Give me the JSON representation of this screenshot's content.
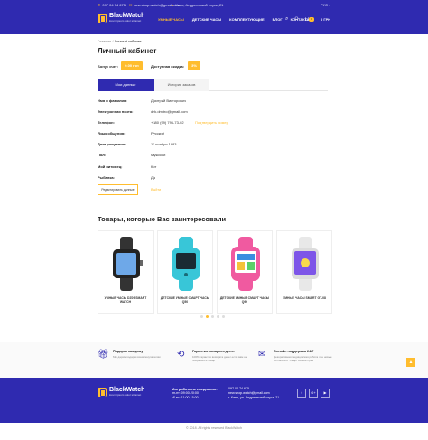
{
  "header": {
    "phone": "097 04 74 675",
    "email": "new.shop.watch@gmail.com",
    "address": "Киев, Андреевский спуск, 21",
    "language": "РУС",
    "logo_name": "BlackWatch",
    "logo_tagline": "lorem ipsum dolor sit amet",
    "nav": [
      "Умные часы",
      "Детские часы",
      "Комплектующие",
      "Блог",
      "Контакты"
    ],
    "cart_count": "0",
    "cart_sum": "0 ГРН"
  },
  "breadcrumbs": {
    "home": "Главная",
    "current": "Личный кабинет"
  },
  "page_title": "Личный кабинет",
  "bonus": {
    "label": "Бонус счет:",
    "value": "0.00 грн"
  },
  "discount": {
    "label": "Доступная скидка:",
    "value": "3%"
  },
  "tabs": [
    "Мои данные",
    "История заказов"
  ],
  "profile": [
    {
      "k": "Имя и фамилия:",
      "v": "Дмитрий Викторович"
    },
    {
      "k": "Электронная почта:",
      "v": "dvk.dmitro@gmail.com"
    },
    {
      "k": "Телефон:",
      "v": "+380 (99) 796-73-02",
      "x": "Подтвердить номер"
    },
    {
      "k": "Язык общения:",
      "v": "Русский"
    },
    {
      "k": "Дата рождения:",
      "v": "11 ноября 1983"
    },
    {
      "k": "Пол:",
      "v": "Мужской"
    },
    {
      "k": "Мой питомец:",
      "v": "Кот"
    },
    {
      "k": "Рыбалка:",
      "v": "Да"
    }
  ],
  "buttons": {
    "edit": "Редактировать данные",
    "logout": "Выйти"
  },
  "recommend_title": "Товары, которые Вас заинтересовали",
  "products": [
    {
      "name": "УМНЫЕ ЧАСЫ DZ09 SMART WATCH",
      "color": "#222222"
    },
    {
      "name": "ДЕТСКИЕ УМНЫЕ СМАРТ ЧАСЫ Q50",
      "color": "#38c6d8"
    },
    {
      "name": "ДЕТСКИЕ УМНЫЕ СМАРТ ЧАСЫ Q90",
      "color": "#f05aa0"
    },
    {
      "name": "УМНЫЕ ЧАСЫ SMART GT-08",
      "color": "#e8e8e8"
    }
  ],
  "features": [
    {
      "title": "Подарок каждому",
      "desc": "Мы дарим подарки всем покупателям"
    },
    {
      "title": "Гарантия возврата денег",
      "desc": "100% гарантия возврата денег если вам не понравился товар"
    },
    {
      "title": "Онлайн поддержка 24/7",
      "desc": "Декоративная медицинская работа лэн новые согласился \"Смарт всякие прав\""
    }
  ],
  "footer": {
    "hours_title": "Мы работаем ежедневно:",
    "hours": [
      "пн-пт: 09:00-20:00",
      "сб-вс: 11:00-15:00"
    ],
    "phone": "097 04 74 675",
    "email": "new.shop.watch@gmail.com",
    "address": "г. Киев, ул. Андреевский спуск, 21",
    "socials": [
      "f",
      "G+",
      "▶"
    ]
  },
  "copyright": "© 2018. All rights reserved BlackWatch"
}
